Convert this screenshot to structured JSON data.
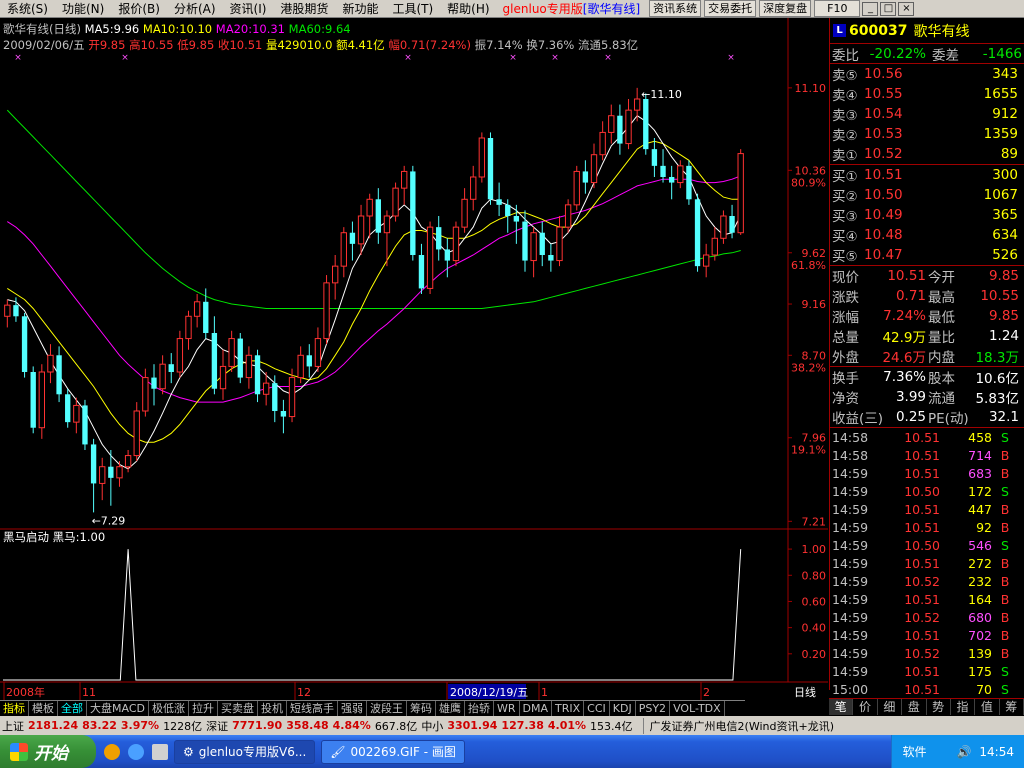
{
  "menubar": {
    "items": [
      "系统(S)",
      "功能(N)",
      "报价(B)",
      "分析(A)",
      "资讯(I)",
      "港股期货",
      "新功能",
      "工具(T)",
      "帮助(H)"
    ],
    "app_title": "glenluo专用版",
    "doc_title": "[歌华有线]",
    "right_buttons": [
      "资讯系统",
      "交易委托",
      "深度复盘",
      "F10"
    ],
    "window_buttons": [
      "_",
      "□",
      "×"
    ]
  },
  "chart_info": {
    "line1": {
      "title": "歌华有线(日线)",
      "ma5": "MA5:9.96",
      "ma10": "MA10:10.10",
      "ma20": "MA20:10.31",
      "ma60": "MA60:9.64"
    },
    "line2": {
      "date": "2009/02/06/五",
      "open": "开9.85",
      "high": "高10.55",
      "low": "低9.85",
      "close": "收10.51",
      "vol": "量429010.0",
      "amt": "额4.41亿",
      "chg": "幅0.71(7.24%)",
      "amp": "振7.14%",
      "turn": "换7.36%",
      "float": "流通5.83亿"
    },
    "indicator_title": "黑马启动  黑马:1.00",
    "period_label": "日线",
    "date_marker": "2008/12/19/五"
  },
  "colors": {
    "up": "#ff3232",
    "down": "#54ffff",
    "ma5": "#ffffff",
    "ma10": "#ffff00",
    "ma20": "#ff00ff",
    "ma60": "#00e600",
    "axis": "#a00000"
  },
  "chart_data": {
    "type": "candlestick",
    "title": "歌华有线(日线)",
    "price_axis_ticks": [
      "11.10",
      "10.36",
      "9.62",
      "9.16",
      "8.70",
      "7.96",
      "7.21"
    ],
    "pct_labels": [
      "80.9%",
      "61.8%",
      "38.2%",
      "19.1%"
    ],
    "indicator_axis_ticks": [
      "1.00",
      "0.80",
      "0.60",
      "0.40",
      "0.20"
    ],
    "x_labels": [
      "2008年",
      "11",
      "12",
      "2008/12/19/五",
      "1",
      "2"
    ],
    "high_annotation": "11.10",
    "low_annotation": "7.29",
    "candles": [
      [
        9.05,
        9.15,
        8.95,
        9.2
      ],
      [
        9.15,
        9.05,
        9.0,
        9.22
      ],
      [
        9.05,
        8.55,
        8.5,
        9.08
      ],
      [
        8.55,
        8.05,
        8.0,
        8.6
      ],
      [
        8.05,
        8.55,
        7.95,
        8.62
      ],
      [
        8.55,
        8.7,
        8.45,
        8.8
      ],
      [
        8.7,
        8.35,
        8.28,
        8.78
      ],
      [
        8.35,
        8.1,
        8.05,
        8.4
      ],
      [
        8.1,
        8.25,
        8.0,
        8.32
      ],
      [
        8.25,
        7.9,
        7.85,
        8.3
      ],
      [
        7.9,
        7.55,
        7.29,
        7.95
      ],
      [
        7.55,
        7.7,
        7.4,
        7.78
      ],
      [
        7.7,
        7.6,
        7.35,
        7.85
      ],
      [
        7.6,
        7.7,
        7.52,
        7.75
      ],
      [
        7.7,
        7.8,
        7.65,
        7.85
      ],
      [
        7.8,
        8.2,
        7.75,
        8.28
      ],
      [
        8.2,
        8.5,
        8.15,
        8.58
      ],
      [
        8.5,
        8.4,
        8.25,
        8.62
      ],
      [
        8.4,
        8.62,
        8.35,
        8.7
      ],
      [
        8.62,
        8.55,
        8.45,
        8.72
      ],
      [
        8.55,
        8.85,
        8.5,
        8.92
      ],
      [
        8.85,
        9.05,
        8.75,
        9.1
      ],
      [
        9.05,
        9.18,
        8.95,
        9.25
      ],
      [
        9.18,
        8.9,
        8.85,
        9.3
      ],
      [
        8.9,
        8.4,
        8.35,
        9.05
      ],
      [
        8.4,
        8.6,
        8.3,
        8.75
      ],
      [
        8.6,
        8.85,
        8.55,
        8.92
      ],
      [
        8.85,
        8.5,
        8.45,
        8.9
      ],
      [
        8.5,
        8.7,
        8.4,
        8.78
      ],
      [
        8.7,
        8.35,
        8.28,
        8.75
      ],
      [
        8.35,
        8.45,
        8.25,
        8.55
      ],
      [
        8.45,
        8.2,
        8.1,
        8.52
      ],
      [
        8.2,
        8.15,
        8.0,
        8.3
      ],
      [
        8.15,
        8.5,
        8.1,
        8.58
      ],
      [
        8.5,
        8.7,
        8.45,
        8.78
      ],
      [
        8.7,
        8.6,
        8.5,
        8.8
      ],
      [
        8.6,
        8.85,
        8.55,
        8.95
      ],
      [
        8.85,
        9.35,
        8.8,
        9.42
      ],
      [
        9.35,
        9.5,
        9.2,
        9.6
      ],
      [
        9.5,
        9.8,
        9.4,
        9.85
      ],
      [
        9.8,
        9.7,
        9.55,
        9.9
      ],
      [
        9.7,
        9.95,
        9.6,
        10.05
      ],
      [
        9.95,
        10.1,
        9.75,
        10.15
      ],
      [
        10.1,
        9.8,
        9.7,
        10.2
      ],
      [
        9.8,
        9.95,
        9.5,
        10.0
      ],
      [
        9.95,
        10.2,
        9.9,
        10.25
      ],
      [
        10.2,
        10.35,
        10.05,
        10.4
      ],
      [
        10.35,
        9.6,
        9.55,
        10.4
      ],
      [
        9.6,
        9.3,
        9.25,
        9.7
      ],
      [
        9.3,
        9.85,
        9.25,
        9.9
      ],
      [
        9.85,
        9.65,
        9.55,
        9.95
      ],
      [
        9.65,
        9.55,
        9.4,
        9.75
      ],
      [
        9.55,
        9.85,
        9.5,
        9.9
      ],
      [
        9.85,
        10.1,
        9.8,
        10.2
      ],
      [
        10.1,
        10.3,
        10.0,
        10.4
      ],
      [
        10.3,
        10.65,
        10.25,
        10.7
      ],
      [
        10.65,
        10.1,
        10.05,
        10.7
      ],
      [
        10.1,
        10.05,
        9.95,
        10.25
      ],
      [
        10.05,
        9.95,
        9.8,
        10.1
      ],
      [
        9.95,
        9.9,
        9.7,
        10.05
      ],
      [
        9.9,
        9.55,
        9.45,
        10.0
      ],
      [
        9.55,
        9.8,
        9.4,
        9.85
      ],
      [
        9.8,
        9.6,
        9.5,
        9.9
      ],
      [
        9.6,
        9.55,
        9.45,
        9.7
      ],
      [
        9.55,
        9.85,
        9.5,
        9.95
      ],
      [
        9.85,
        10.05,
        9.8,
        10.1
      ],
      [
        10.05,
        10.35,
        10.0,
        10.4
      ],
      [
        10.35,
        10.25,
        10.15,
        10.45
      ],
      [
        10.25,
        10.5,
        10.2,
        10.6
      ],
      [
        10.5,
        10.7,
        10.45,
        10.8
      ],
      [
        10.7,
        10.85,
        10.6,
        10.95
      ],
      [
        10.85,
        10.6,
        10.5,
        10.95
      ],
      [
        10.6,
        10.9,
        10.55,
        11.0
      ],
      [
        10.9,
        11.0,
        10.8,
        11.1
      ],
      [
        11.0,
        10.55,
        10.5,
        11.05
      ],
      [
        10.55,
        10.4,
        10.3,
        10.65
      ],
      [
        10.4,
        10.3,
        10.25,
        10.55
      ],
      [
        10.3,
        10.25,
        10.1,
        10.4
      ],
      [
        10.25,
        10.4,
        10.2,
        10.45
      ],
      [
        10.4,
        10.1,
        10.05,
        10.45
      ],
      [
        10.1,
        9.5,
        9.45,
        10.15
      ],
      [
        9.5,
        9.6,
        9.4,
        9.7
      ],
      [
        9.6,
        9.75,
        9.55,
        9.85
      ],
      [
        9.75,
        9.95,
        9.7,
        10.0
      ],
      [
        9.95,
        9.8,
        9.75,
        10.05
      ],
      [
        9.8,
        10.51,
        9.78,
        10.55
      ]
    ],
    "ma5": [
      9.2,
      9.18,
      9.1,
      8.95,
      8.8,
      8.65,
      8.52,
      8.4,
      8.3,
      8.2,
      8.05,
      7.9,
      7.8,
      7.72,
      7.68,
      7.75,
      7.88,
      8.02,
      8.18,
      8.35,
      8.5,
      8.6,
      8.75,
      8.85,
      8.82,
      8.75,
      8.72,
      8.65,
      8.62,
      8.6,
      8.52,
      8.45,
      8.38,
      8.35,
      8.4,
      8.48,
      8.58,
      8.8,
      9.02,
      9.25,
      9.48,
      9.62,
      9.78,
      9.85,
      9.9,
      9.98,
      10.05,
      9.98,
      9.85,
      9.8,
      9.7,
      9.62,
      9.65,
      9.75,
      9.85,
      10.02,
      10.1,
      10.08,
      10.05,
      10.0,
      9.92,
      9.85,
      9.78,
      9.7,
      9.72,
      9.8,
      9.92,
      10.08,
      10.25,
      10.42,
      10.58,
      10.66,
      10.75,
      10.85,
      10.8,
      10.72,
      10.6,
      10.48,
      10.38,
      10.3,
      10.12,
      9.95,
      9.85,
      9.78,
      9.8,
      9.96
    ],
    "ma10": [
      9.3,
      9.25,
      9.2,
      9.12,
      9.02,
      8.92,
      8.82,
      8.72,
      8.62,
      8.52,
      8.42,
      8.3,
      8.18,
      8.08,
      8.0,
      7.95,
      7.92,
      7.92,
      7.95,
      8.0,
      8.08,
      8.18,
      8.28,
      8.38,
      8.45,
      8.52,
      8.58,
      8.62,
      8.65,
      8.65,
      8.62,
      8.58,
      8.55,
      8.52,
      8.5,
      8.48,
      8.5,
      8.58,
      8.7,
      8.82,
      8.98,
      9.12,
      9.28,
      9.42,
      9.55,
      9.68,
      9.78,
      9.82,
      9.82,
      9.8,
      9.78,
      9.75,
      9.75,
      9.75,
      9.78,
      9.82,
      9.88,
      9.92,
      9.95,
      9.98,
      9.98,
      9.95,
      9.92,
      9.88,
      9.85,
      9.85,
      9.88,
      9.95,
      10.05,
      10.15,
      10.25,
      10.35,
      10.45,
      10.55,
      10.6,
      10.62,
      10.6,
      10.55,
      10.5,
      10.45,
      10.35,
      10.25,
      10.18,
      10.12,
      10.1,
      10.1
    ],
    "ma20": [
      9.9,
      9.85,
      9.78,
      9.7,
      9.6,
      9.5,
      9.4,
      9.3,
      9.2,
      9.1,
      9.0,
      8.9,
      8.8,
      8.7,
      8.62,
      8.55,
      8.48,
      8.42,
      8.38,
      8.35,
      8.32,
      8.3,
      8.28,
      8.28,
      8.28,
      8.28,
      8.3,
      8.32,
      8.35,
      8.38,
      8.4,
      8.42,
      8.42,
      8.42,
      8.42,
      8.44,
      8.46,
      8.5,
      8.55,
      8.62,
      8.7,
      8.78,
      8.85,
      8.92,
      8.98,
      9.05,
      9.12,
      9.2,
      9.28,
      9.35,
      9.42,
      9.48,
      9.52,
      9.56,
      9.6,
      9.65,
      9.7,
      9.75,
      9.78,
      9.82,
      9.85,
      9.88,
      9.9,
      9.92,
      9.94,
      9.96,
      9.98,
      10.0,
      10.03,
      10.06,
      10.1,
      10.14,
      10.18,
      10.22,
      10.24,
      10.26,
      10.28,
      10.28,
      10.28,
      10.28,
      10.26,
      10.25,
      10.25,
      10.26,
      10.28,
      10.31
    ],
    "ma60": [
      10.9,
      10.82,
      10.74,
      10.66,
      10.58,
      10.5,
      10.42,
      10.34,
      10.26,
      10.18,
      10.1,
      10.02,
      9.94,
      9.86,
      9.78,
      9.7,
      9.62,
      9.55,
      9.48,
      9.42,
      9.36,
      9.31,
      9.27,
      9.23,
      9.2,
      9.18,
      9.16,
      9.15,
      9.14,
      9.13,
      9.12,
      9.12,
      9.12,
      9.12,
      9.12,
      9.12,
      9.12,
      9.12,
      9.12,
      9.12,
      9.12,
      9.12,
      9.12,
      9.12,
      9.12,
      9.12,
      9.12,
      9.12,
      9.12,
      9.12,
      9.12,
      9.12,
      9.12,
      9.12,
      9.12,
      9.12,
      9.13,
      9.14,
      9.15,
      9.16,
      9.17,
      9.18,
      9.2,
      9.22,
      9.24,
      9.26,
      9.28,
      9.3,
      9.32,
      9.34,
      9.36,
      9.38,
      9.4,
      9.42,
      9.44,
      9.46,
      9.48,
      9.5,
      9.52,
      9.54,
      9.56,
      9.58,
      9.59,
      9.61,
      9.62,
      9.64
    ],
    "indicator": {
      "name": "黑马",
      "spikes": [
        {
          "index": 14,
          "value": 1.0
        },
        {
          "index": 85,
          "value": 1.0
        }
      ],
      "ylim": [
        0,
        1.1
      ]
    },
    "ylim": [
      7.15,
      11.35
    ]
  },
  "right_panel": {
    "code": "600037",
    "name": "歌华有线",
    "weibi_label": "委比",
    "weibi": "-20.22%",
    "weicha_label": "委差",
    "weicha": "-1466",
    "asks": [
      {
        "label": "卖⑤",
        "price": "10.56",
        "vol": "343"
      },
      {
        "label": "卖④",
        "price": "10.55",
        "vol": "1655"
      },
      {
        "label": "卖③",
        "price": "10.54",
        "vol": "912"
      },
      {
        "label": "卖②",
        "price": "10.53",
        "vol": "1359"
      },
      {
        "label": "卖①",
        "price": "10.52",
        "vol": "89"
      }
    ],
    "bids": [
      {
        "label": "买①",
        "price": "10.51",
        "vol": "300"
      },
      {
        "label": "买②",
        "price": "10.50",
        "vol": "1067"
      },
      {
        "label": "买③",
        "price": "10.49",
        "vol": "365"
      },
      {
        "label": "买④",
        "price": "10.48",
        "vol": "634"
      },
      {
        "label": "买⑤",
        "price": "10.47",
        "vol": "526"
      }
    ],
    "quote1": [
      {
        "l": "现价",
        "v": "10.51",
        "c": "red",
        "l2": "今开",
        "v2": "9.85",
        "c2": "red"
      },
      {
        "l": "涨跌",
        "v": "0.71",
        "c": "red",
        "l2": "最高",
        "v2": "10.55",
        "c2": "red"
      },
      {
        "l": "涨幅",
        "v": "7.24%",
        "c": "red",
        "l2": "最低",
        "v2": "9.85",
        "c2": "red"
      },
      {
        "l": "总量",
        "v": "42.9万",
        "c": "yellow",
        "l2": "量比",
        "v2": "1.24",
        "c2": "white"
      },
      {
        "l": "外盘",
        "v": "24.6万",
        "c": "red",
        "l2": "内盘",
        "v2": "18.3万",
        "c2": "green"
      }
    ],
    "quote2": [
      {
        "l": "换手",
        "v": "7.36%",
        "c": "white",
        "l2": "股本",
        "v2": "10.6亿",
        "c2": "white"
      },
      {
        "l": "净资",
        "v": "3.99",
        "c": "white",
        "l2": "流通",
        "v2": "5.83亿",
        "c2": "white"
      },
      {
        "l": "收益(三)",
        "v": "0.25",
        "c": "white",
        "l2": "PE(动)",
        "v2": "32.1",
        "c2": "white"
      }
    ],
    "ticks": [
      {
        "t": "14:58",
        "p": "10.51",
        "v": "458",
        "vc": "yellow",
        "d": "S",
        "dc": "green"
      },
      {
        "t": "14:58",
        "p": "10.51",
        "v": "714",
        "vc": "purple",
        "d": "B",
        "dc": "red"
      },
      {
        "t": "14:59",
        "p": "10.51",
        "v": "683",
        "vc": "purple",
        "d": "B",
        "dc": "red"
      },
      {
        "t": "14:59",
        "p": "10.50",
        "v": "172",
        "vc": "yellow",
        "d": "S",
        "dc": "green"
      },
      {
        "t": "14:59",
        "p": "10.51",
        "v": "447",
        "vc": "yellow",
        "d": "B",
        "dc": "red"
      },
      {
        "t": "14:59",
        "p": "10.51",
        "v": "92",
        "vc": "yellow",
        "d": "B",
        "dc": "red"
      },
      {
        "t": "14:59",
        "p": "10.50",
        "v": "546",
        "vc": "purple",
        "d": "S",
        "dc": "green"
      },
      {
        "t": "14:59",
        "p": "10.51",
        "v": "272",
        "vc": "yellow",
        "d": "B",
        "dc": "red"
      },
      {
        "t": "14:59",
        "p": "10.52",
        "v": "232",
        "vc": "yellow",
        "d": "B",
        "dc": "red"
      },
      {
        "t": "14:59",
        "p": "10.51",
        "v": "164",
        "vc": "yellow",
        "d": "B",
        "dc": "red"
      },
      {
        "t": "14:59",
        "p": "10.52",
        "v": "680",
        "vc": "purple",
        "d": "B",
        "dc": "red"
      },
      {
        "t": "14:59",
        "p": "10.51",
        "v": "702",
        "vc": "purple",
        "d": "B",
        "dc": "red"
      },
      {
        "t": "14:59",
        "p": "10.52",
        "v": "139",
        "vc": "yellow",
        "d": "B",
        "dc": "red"
      },
      {
        "t": "14:59",
        "p": "10.51",
        "v": "175",
        "vc": "yellow",
        "d": "S",
        "dc": "green"
      },
      {
        "t": "15:00",
        "p": "10.51",
        "v": "70",
        "vc": "yellow",
        "d": "S",
        "dc": "green"
      }
    ],
    "tabs": [
      "笔",
      "价",
      "细",
      "盘",
      "势",
      "指",
      "值",
      "筹"
    ]
  },
  "bottom_tabs": [
    "指标",
    "模板",
    "全部",
    "大盘MACD",
    "极低涨",
    "拉升",
    "买卖盘",
    "投机",
    "短线高手",
    "强弱",
    "波段王",
    "筹码",
    "雄鹰",
    "抬轿",
    "WR",
    "DMA",
    "TRIX",
    "CCI",
    "KDJ",
    "PSY2",
    "VOL-TDX"
  ],
  "status_bar": {
    "sh_label": "上证",
    "sh_val": "2181.24",
    "sh_chg": "83.22",
    "sh_pct": "3.97%",
    "sh_amt": "1228亿",
    "sz_label": "深证",
    "sz_val": "7771.90",
    "sz_chg": "358.48",
    "sz_pct": "4.84%",
    "sz_amt": "667.8亿",
    "zx_label": "中小",
    "zx_val": "3301.94",
    "zx_chg": "127.38",
    "zx_pct": "4.01%",
    "zx_amt": "153.4亿",
    "broker": "广发证券广州电信2(Wind资讯+龙讯)"
  },
  "taskbar": {
    "start": "开始",
    "tasks": [
      "glenluo专用版V6...",
      "002269.GIF - 画图"
    ],
    "tray_label": "软件",
    "clock": "14:54"
  }
}
